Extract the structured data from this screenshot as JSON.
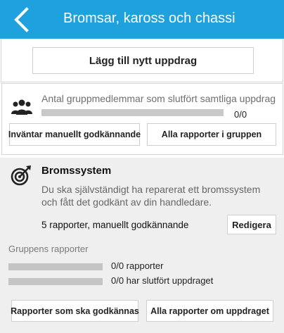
{
  "header": {
    "title": "Bromsar, kaross och chassi",
    "back_icon": "chevron-left-icon",
    "color": "#1ea1dc"
  },
  "actions": {
    "add_task_label": "Lägg till nytt uppdrag"
  },
  "group": {
    "icon": "group-icon",
    "completed_text": "Antal gruppmedlemmar som slutfört samtliga uppdrag",
    "completed_count": "0/0",
    "progress": 0,
    "pending_label": "Inväntar manuellt godkännande",
    "all_reports_label": "Alla rapporter i gruppen"
  },
  "task": {
    "icon": "target-icon",
    "title": "Bromssystem",
    "description": "Du ska självständigt ha reparerat ett bromssystem och fått det godkänt av din handledare.",
    "reports_text": "5 rapporter, manuellt godkännande",
    "edit_label": "Redigera",
    "group_reports_label": "Gruppens rapporter",
    "reports_count_text": "0/0 rapporter",
    "reports_progress": 0,
    "completed_text": "0/0 har slutfört uppdraget",
    "completed_progress": 0,
    "to_approve_label": "Rapporter som ska godkännas",
    "all_reports_label": "Alla rapporter om uppdraget"
  }
}
